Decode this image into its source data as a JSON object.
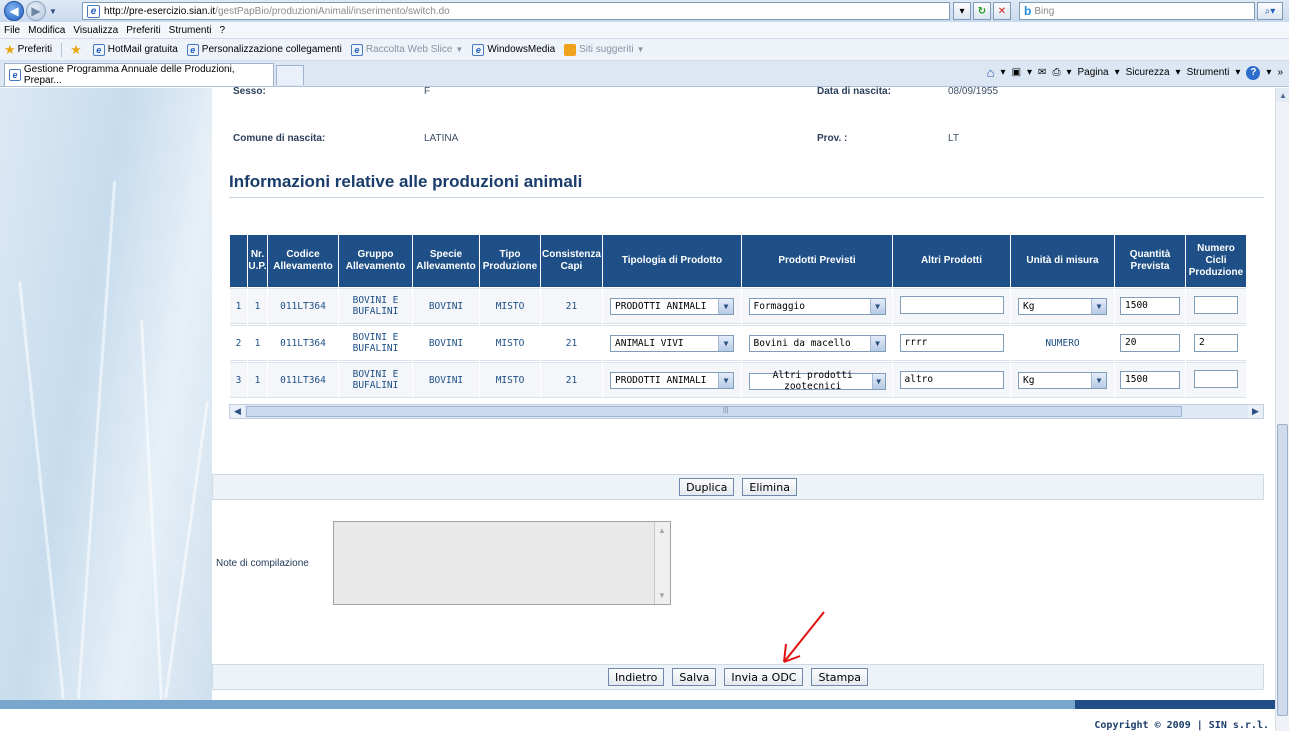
{
  "browser": {
    "url_domain": "http://pre-esercizio.sian.it",
    "url_path": "/gestPapBio/produzioniAnimali/inserimento/switch.do",
    "search_placeholder": "Bing",
    "menu": [
      "File",
      "Modifica",
      "Visualizza",
      "Preferiti",
      "Strumenti",
      "?"
    ],
    "favorites_label": "Preferiti",
    "favorites": [
      {
        "label": "HotMail gratuita",
        "dim": false
      },
      {
        "label": "Personalizzazione collegamenti",
        "dim": false
      },
      {
        "label": "Raccolta Web Slice",
        "dim": true
      },
      {
        "label": "WindowsMedia",
        "dim": false
      },
      {
        "label": "Siti suggeriti",
        "dim": true
      }
    ],
    "tab_title": "Gestione Programma Annuale delle Produzioni, Prepar...",
    "commands": [
      "Pagina",
      "Sicurezza",
      "Strumenti"
    ]
  },
  "person": {
    "sesso_label": "Sesso:",
    "sesso_value": "F",
    "data_label": "Data di nascita:",
    "data_value": "08/09/1955",
    "comune_label": "Comune di nascita:",
    "comune_value": "LATINA",
    "prov_label": "Prov. :",
    "prov_value": "LT"
  },
  "section_title": "Informazioni relative alle produzioni animali",
  "table": {
    "headers": [
      "",
      "Nr. U.P.",
      "Codice Allevamento",
      "Gruppo Allevamento",
      "Specie Allevamento",
      "Tipo Produzione",
      "Consistenza Capi",
      "Tipologia di Prodotto",
      "Prodotti Previsti",
      "Altri Prodotti",
      "Unità di misura",
      "Quantità Prevista",
      "Numero Cicli Produzione"
    ],
    "rows": [
      {
        "idx": "1",
        "nr_up": "1",
        "codice": "011LT364",
        "gruppo": "BOVINI E BUFALINI",
        "specie": "BOVINI",
        "tipo": "MISTO",
        "capi": "21",
        "tipologia": "PRODOTTI ANIMALI",
        "previsti": "Formaggio",
        "altri": "",
        "unita": "Kg",
        "unita_select": true,
        "quantita": "1500",
        "cicli": ""
      },
      {
        "idx": "2",
        "nr_up": "1",
        "codice": "011LT364",
        "gruppo": "BOVINI E BUFALINI",
        "specie": "BOVINI",
        "tipo": "MISTO",
        "capi": "21",
        "tipologia": "ANIMALI VIVI",
        "previsti": "Bovini da macello",
        "altri": "rrrr",
        "unita": "NUMERO",
        "unita_select": false,
        "quantita": "20",
        "cicli": "2"
      },
      {
        "idx": "3",
        "nr_up": "1",
        "codice": "011LT364",
        "gruppo": "BOVINI E BUFALINI",
        "specie": "BOVINI",
        "tipo": "MISTO",
        "capi": "21",
        "tipologia": "PRODOTTI ANIMALI",
        "previsti": "Altri prodotti zootecnici",
        "altri": "altro",
        "unita": "Kg",
        "unita_select": true,
        "quantita": "1500",
        "cicli": ""
      }
    ]
  },
  "actions_top": {
    "duplica": "Duplica",
    "elimina": "Elimina"
  },
  "note_label": "Note di compilazione",
  "note_value": "",
  "actions_bottom": {
    "indietro": "Indietro",
    "salva": "Salva",
    "invia": "Invia a ODC",
    "stampa": "Stampa"
  },
  "copyright": "Copyright © 2009 | SIN s.r.l.",
  "colors": {
    "header_blue": "#1e4f86",
    "annotation_red": "#e01010"
  }
}
